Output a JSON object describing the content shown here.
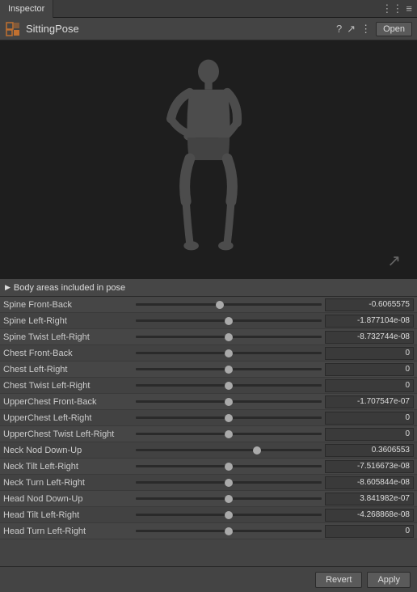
{
  "tab": {
    "label": "Inspector",
    "icons": [
      "⋮⋮",
      "≡"
    ]
  },
  "header": {
    "title": "SittingPose",
    "open_label": "Open",
    "icons": [
      "?",
      "↗",
      "⋮"
    ]
  },
  "section": {
    "label": "Body areas included in pose"
  },
  "sliders": [
    {
      "label": "Spine Front-Back",
      "thumb_pct": 45,
      "value": "-0.6065575"
    },
    {
      "label": "Spine Left-Right",
      "thumb_pct": 50,
      "value": "-1.877104e-08"
    },
    {
      "label": "Spine Twist Left-Right",
      "thumb_pct": 50,
      "value": "-8.732744e-08"
    },
    {
      "label": "Chest Front-Back",
      "thumb_pct": 50,
      "value": "0"
    },
    {
      "label": "Chest Left-Right",
      "thumb_pct": 50,
      "value": "0"
    },
    {
      "label": "Chest Twist Left-Right",
      "thumb_pct": 50,
      "value": "0"
    },
    {
      "label": "UpperChest Front-Back",
      "thumb_pct": 50,
      "value": "-1.707547e-07"
    },
    {
      "label": "UpperChest Left-Right",
      "thumb_pct": 50,
      "value": "0"
    },
    {
      "label": "UpperChest Twist Left-Right",
      "thumb_pct": 50,
      "value": "0"
    },
    {
      "label": "Neck Nod Down-Up",
      "thumb_pct": 65,
      "value": "0.3606553"
    },
    {
      "label": "Neck Tilt Left-Right",
      "thumb_pct": 50,
      "value": "-7.516673e-08"
    },
    {
      "label": "Neck Turn Left-Right",
      "thumb_pct": 50,
      "value": "-8.605844e-08"
    },
    {
      "label": "Head Nod Down-Up",
      "thumb_pct": 50,
      "value": "3.841982e-07"
    },
    {
      "label": "Head Tilt Left-Right",
      "thumb_pct": 50,
      "value": "-4.268868e-08"
    },
    {
      "label": "Head Turn Left-Right",
      "thumb_pct": 50,
      "value": "0"
    }
  ],
  "footer": {
    "revert_label": "Revert",
    "apply_label": "Apply"
  }
}
